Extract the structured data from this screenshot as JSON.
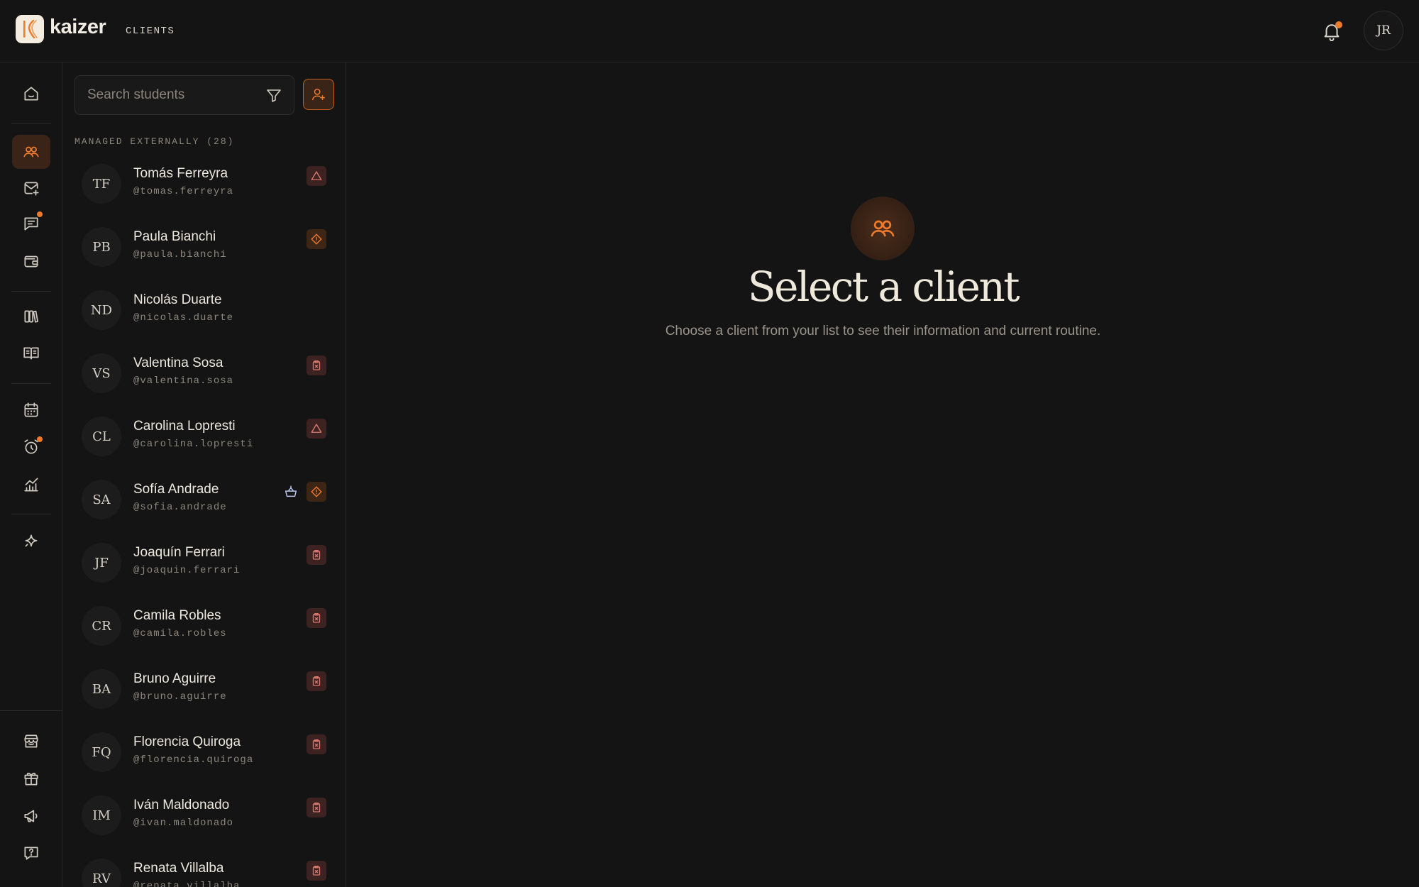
{
  "app": {
    "name": "kaizer",
    "section": "CLIENTS"
  },
  "header": {
    "user_initials": "JR",
    "has_notification": true
  },
  "search": {
    "placeholder": "Search students"
  },
  "group": {
    "label": "MANAGED EXTERNALLY (28)"
  },
  "clients": [
    {
      "initials": "TF",
      "name": "Tomás Ferreyra",
      "handle": "@tomas.ferreyra",
      "status": "warning"
    },
    {
      "initials": "PB",
      "name": "Paula Bianchi",
      "handle": "@paula.bianchi",
      "status": "alert"
    },
    {
      "initials": "ND",
      "name": "Nicolás Duarte",
      "handle": "@nicolas.duarte",
      "status": "none"
    },
    {
      "initials": "VS",
      "name": "Valentina Sosa",
      "handle": "@valentina.sosa",
      "status": "no-routine"
    },
    {
      "initials": "CL",
      "name": "Carolina Lopresti",
      "handle": "@carolina.lopresti",
      "status": "warning"
    },
    {
      "initials": "SA",
      "name": "Sofía Andrade",
      "handle": "@sofia.andrade",
      "status": "alert",
      "extra": "basket"
    },
    {
      "initials": "JF",
      "name": "Joaquín Ferrari",
      "handle": "@joaquin.ferrari",
      "status": "no-routine"
    },
    {
      "initials": "CR",
      "name": "Camila Robles",
      "handle": "@camila.robles",
      "status": "no-routine"
    },
    {
      "initials": "BA",
      "name": "Bruno Aguirre",
      "handle": "@bruno.aguirre",
      "status": "no-routine"
    },
    {
      "initials": "FQ",
      "name": "Florencia Quiroga",
      "handle": "@florencia.quiroga",
      "status": "no-routine"
    },
    {
      "initials": "IM",
      "name": "Iván Maldonado",
      "handle": "@ivan.maldonado",
      "status": "no-routine"
    },
    {
      "initials": "RV",
      "name": "Renata Villalba",
      "handle": "@renata.villalba",
      "status": "no-routine"
    }
  ],
  "empty_state": {
    "title": "Select a client",
    "subtitle": "Choose a client from your list to see their information and current routine."
  },
  "colors": {
    "accent": "#ee7b2c",
    "danger_chip": "#3d2222",
    "warning_chip": "#3e2616"
  }
}
